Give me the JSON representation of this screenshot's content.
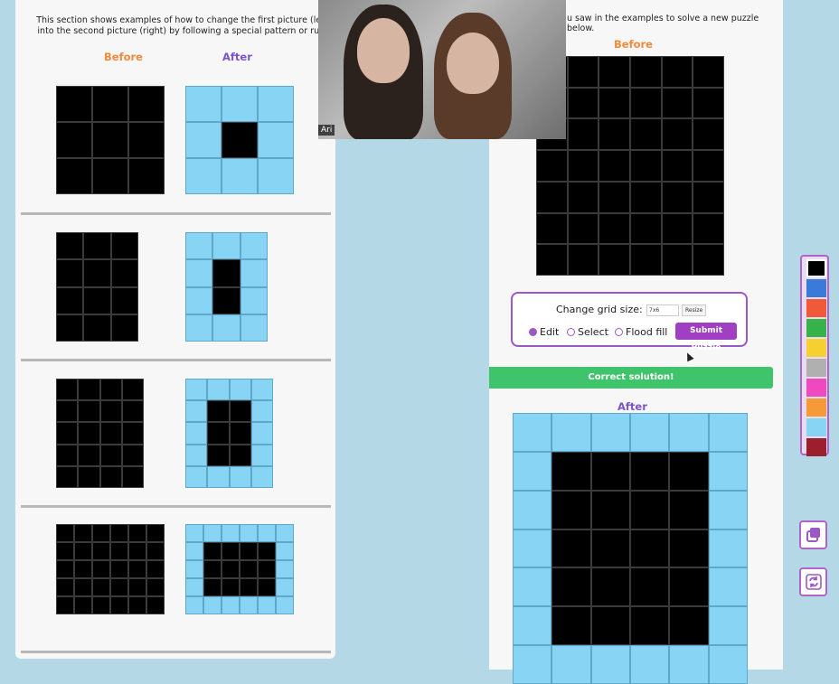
{
  "instructions": {
    "left_text": "This section shows examples of how to change the first picture (left) into the second picture (right) by following a special pattern or rule.",
    "right_text": "u saw in the examples to solve a new puzzle below."
  },
  "labels": {
    "before": "Before",
    "after": "After"
  },
  "colors": {
    "black": "#000000",
    "blue": "#87d4f5",
    "accent": "#9b59c6",
    "success": "#3fc46b"
  },
  "examples": [
    {
      "before": {
        "rows": 3,
        "cols": 3
      },
      "after": {
        "rows": 3,
        "cols": 3
      }
    },
    {
      "before": {
        "rows": 4,
        "cols": 3
      },
      "after": {
        "rows": 4,
        "cols": 3
      }
    },
    {
      "before": {
        "rows": 5,
        "cols": 4
      },
      "after": {
        "rows": 5,
        "cols": 4
      }
    },
    {
      "before": {
        "rows": 5,
        "cols": 6
      },
      "after": {
        "rows": 5,
        "cols": 6
      }
    }
  ],
  "puzzle": {
    "before": {
      "rows": 7,
      "cols": 6
    },
    "after": {
      "rows": 7,
      "cols": 6
    }
  },
  "controls": {
    "change_grid_label": "Change grid size:",
    "grid_size_value": "7x6",
    "resize_label": "Resize",
    "modes": [
      "Edit",
      "Select",
      "Flood fill"
    ],
    "selected_mode": "Edit",
    "submit_label": "Submit Puzzle"
  },
  "status": {
    "message": "Correct solution!"
  },
  "video": {
    "participant_name": "Ari"
  },
  "palette": {
    "colors": [
      "#000000",
      "#3a7ad8",
      "#f05a3a",
      "#36b24b",
      "#f6d033",
      "#b0b0b0",
      "#ef49c0",
      "#f59a37",
      "#87d4f5",
      "#9c1f2e"
    ],
    "selected_index": 0
  },
  "tools": {
    "copy_icon": "copy-icon",
    "reset_icon": "refresh-icon"
  }
}
